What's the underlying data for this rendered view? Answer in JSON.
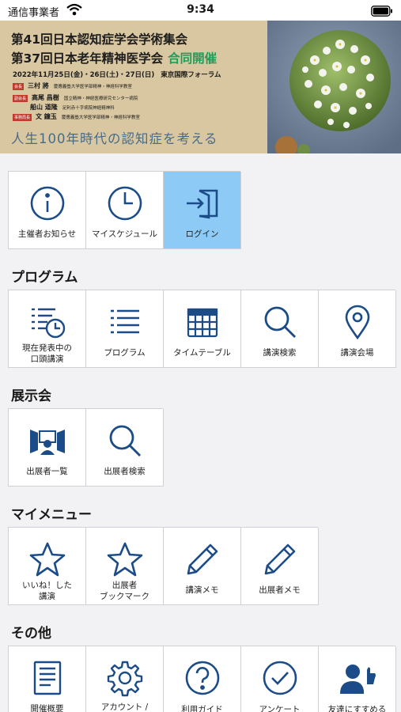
{
  "status_bar": {
    "carrier": "通信事業者",
    "time": "9:34"
  },
  "banner": {
    "title_line1": "第41回日本認知症学会学術集会",
    "title_line2": "第37回日本老年精神医学会",
    "joint": "合同開催",
    "dates": "2022年11月25日(金)・26日(土)・27日(日)",
    "venue": "東京国際フォーラム",
    "roles": [
      {
        "tag": "会長",
        "name": "三村 將",
        "affiliation": "慶應義塾大学医学部精神・神経科学教室"
      },
      {
        "tag": "副会長",
        "name": "高尾 昌樹",
        "affiliation": "国立精神・神経医療研究センター病院"
      },
      {
        "tag": "",
        "name": "船山 道隆",
        "affiliation": "足利赤十字病院神経精神科"
      },
      {
        "tag": "事務局長",
        "name": "文 鐘玉",
        "affiliation": "慶應義塾大学医学部精神・神経科学教室"
      }
    ],
    "slogan": "人生100年時代の認知症を考える"
  },
  "top_menu": [
    {
      "label": "主催者お知らせ",
      "icon": "info-icon",
      "active": false
    },
    {
      "label": "マイスケジュール",
      "icon": "clock-icon",
      "active": false
    },
    {
      "label": "ログイン",
      "icon": "login-icon",
      "active": true
    }
  ],
  "sections": {
    "program": {
      "title": "プログラム",
      "items": [
        {
          "label1": "現在発表中の",
          "label2": "口頭講演",
          "icon": "now-presenting-icon"
        },
        {
          "label1": "プログラム",
          "label2": "",
          "icon": "list-icon"
        },
        {
          "label1": "タイムテーブル",
          "label2": "",
          "icon": "calendar-icon"
        },
        {
          "label1": "講演検索",
          "label2": "",
          "icon": "search-icon"
        },
        {
          "label1": "講演会場",
          "label2": "",
          "icon": "map-pin-icon"
        }
      ]
    },
    "exhibition": {
      "title": "展示会",
      "items": [
        {
          "label1": "出展者一覧",
          "label2": "",
          "icon": "exhibitor-booth-icon"
        },
        {
          "label1": "出展者検索",
          "label2": "",
          "icon": "search-icon"
        }
      ]
    },
    "my_menu": {
      "title": "マイメニュー",
      "items": [
        {
          "label1": "いいね！した",
          "label2": "講演",
          "icon": "star-icon"
        },
        {
          "label1": "出展者",
          "label2": "ブックマーク",
          "icon": "star-icon"
        },
        {
          "label1": "講演メモ",
          "label2": "",
          "icon": "pencil-icon"
        },
        {
          "label1": "出展者メモ",
          "label2": "",
          "icon": "pencil-icon"
        }
      ]
    },
    "other": {
      "title": "その他",
      "items": [
        {
          "label1": "開催概要",
          "label2": "",
          "icon": "document-icon"
        },
        {
          "label1": "アカウント /",
          "label2": "",
          "icon": "gear-icon"
        },
        {
          "label1": "利用ガイド",
          "label2": "",
          "icon": "help-icon"
        },
        {
          "label1": "アンケート",
          "label2": "",
          "icon": "check-circle-icon"
        },
        {
          "label1": "友達にすすめる",
          "label2": "",
          "icon": "recommend-icon"
        }
      ]
    }
  },
  "colors": {
    "icon": "#1c4c87",
    "active_tile": "#8dcaf5",
    "joint_text": "#1f9d5a",
    "slogan": "#4a6b88"
  }
}
